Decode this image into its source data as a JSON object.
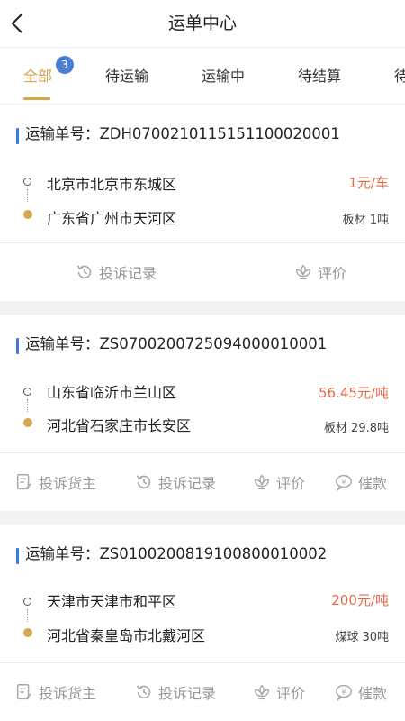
{
  "header": {
    "title": "运单中心"
  },
  "tabs": [
    {
      "label": "全部",
      "badge": "3"
    },
    {
      "label": "待运输"
    },
    {
      "label": "运输中"
    },
    {
      "label": "待结算"
    },
    {
      "label": "待"
    }
  ],
  "orders": [
    {
      "order_label": "运输单号：ZDH0700210115151100020001",
      "origin": "北京市北京市东城区",
      "destination": "广东省广州市天河区",
      "price": "1元/车",
      "cargo": "板材 1吨",
      "actions": [
        "投诉记录",
        "评价"
      ]
    },
    {
      "order_label": "运输单号：ZS0700200725094000010001",
      "origin": "山东省临沂市兰山区",
      "destination": "河北省石家庄市长安区",
      "price": "56.45元/吨",
      "cargo": "板材 29.8吨",
      "actions": [
        "投诉货主",
        "投诉记录",
        "评价",
        "催款"
      ]
    },
    {
      "order_label": "运输单号：ZS0100200819100800010002",
      "origin": "天津市天津市和平区",
      "destination": "河北省秦皇岛市北戴河区",
      "price": "200元/吨",
      "cargo": "煤球 30吨",
      "actions": [
        "投诉货主",
        "投诉记录",
        "评价",
        "催款"
      ]
    }
  ],
  "colors": {
    "accent": "#d4a64f",
    "price": "#e8694a",
    "badge": "#4a7fd6",
    "order_bar": "#3d7be0"
  }
}
